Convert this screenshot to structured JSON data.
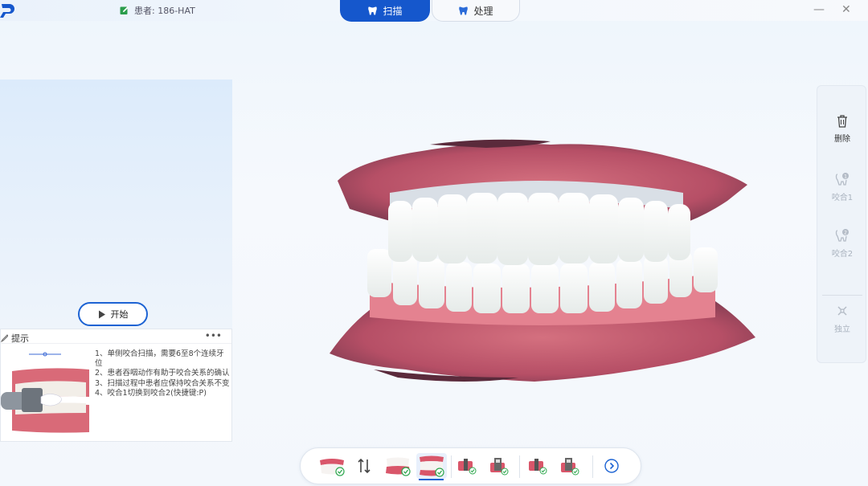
{
  "header": {
    "patient_label": "患者: 186-HAT",
    "tabs": [
      {
        "label": "扫描",
        "active": true
      },
      {
        "label": "处理",
        "active": false
      }
    ],
    "minimize": "—",
    "close": "✕"
  },
  "left_panel": {
    "start_label": "开始",
    "tips_title": "提示",
    "tips_more": "•••",
    "tips": [
      "1、单侧咬合扫描，需要6至8个连续牙位",
      "2、患者吞咽动作有助于咬合关系的确认",
      "3、扫描过程中患者应保持咬合关系不变",
      "4、咬合1切换到咬合2(快捷键:P)"
    ]
  },
  "right_panel": {
    "tools": [
      {
        "label": "删除",
        "icon": "trash-icon",
        "enabled": true
      },
      {
        "label": "咬合1",
        "icon": "bite1-icon",
        "enabled": false
      },
      {
        "label": "咬合2",
        "icon": "bite2-icon",
        "enabled": false
      },
      {
        "label": "独立",
        "icon": "independent-icon",
        "enabled": false
      }
    ]
  },
  "bottom_toolbar": {
    "items": [
      {
        "icon": "lower-jaw-done-icon",
        "active": false
      },
      {
        "icon": "swap-jaw-icon",
        "active": false
      },
      {
        "icon": "upper-jaw-icon",
        "active": false
      },
      {
        "icon": "bite-scan-icon",
        "active": true
      },
      {
        "icon": "implant-1-icon",
        "active": false
      },
      {
        "icon": "implant-2-icon",
        "active": false
      },
      {
        "icon": "implant-3-icon",
        "active": false
      },
      {
        "icon": "implant-4-icon",
        "active": false
      },
      {
        "icon": "next-arrow-icon",
        "active": false
      }
    ]
  },
  "colors": {
    "accent": "#1557cc",
    "check": "#2fa84f",
    "gum": "#c9566f"
  }
}
